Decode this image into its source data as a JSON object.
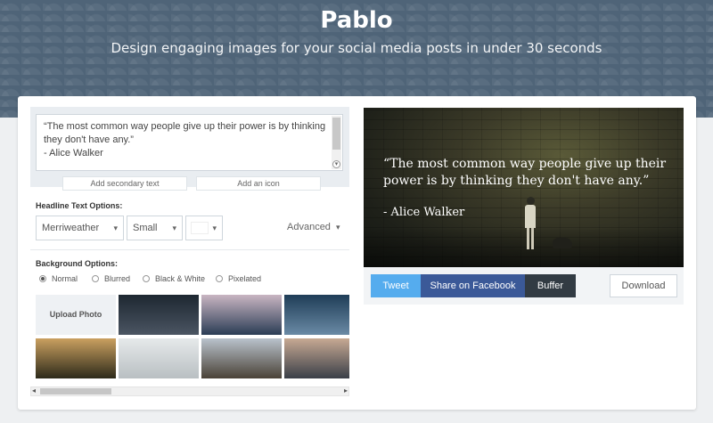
{
  "header": {
    "title": "Pablo",
    "subtitle": "Design engaging images for your social media posts in under 30 seconds"
  },
  "editor": {
    "text_lines": [
      "“The most common way people give up their power is by thinking",
      "they don't have any.”",
      "",
      "- Alice Walker"
    ],
    "add_secondary_text": "Add secondary text",
    "add_icon": "Add an icon"
  },
  "headline_options": {
    "label": "Headline Text Options:",
    "font": "Merriweather",
    "size": "Small",
    "color": "#ffffff",
    "advanced": "Advanced"
  },
  "background_options": {
    "label": "Background Options:",
    "filters": [
      "Normal",
      "Blurred",
      "Black & White",
      "Pixelated"
    ],
    "selected_filter": "Normal",
    "upload_label": "Upload Photo",
    "thumbnails": [
      {
        "name": "thumb-street",
        "colors": [
          "#1d2731",
          "#4b5562"
        ]
      },
      {
        "name": "thumb-bridge",
        "colors": [
          "#c9b5c2",
          "#2b3d55"
        ]
      },
      {
        "name": "thumb-water",
        "colors": [
          "#1f3d57",
          "#6a8aa5"
        ]
      },
      {
        "name": "thumb-sunset-forest",
        "colors": [
          "#caa060",
          "#2d2a1a"
        ]
      },
      {
        "name": "thumb-fog",
        "colors": [
          "#e6e9ea",
          "#b9bfc2"
        ]
      },
      {
        "name": "thumb-hiker",
        "colors": [
          "#b9c2cc",
          "#4a4237"
        ]
      },
      {
        "name": "thumb-city",
        "colors": [
          "#c7a993",
          "#3a3f48"
        ]
      }
    ]
  },
  "preview": {
    "quote": "“The most common way people give up their power is by thinking they don't have any.”",
    "author": "- Alice Walker"
  },
  "share": {
    "tweet": "Tweet",
    "facebook": "Share on Facebook",
    "buffer": "Buffer",
    "download": "Download"
  },
  "colors": {
    "tweet": "#55acee",
    "facebook": "#3b5998",
    "buffer": "#323b43",
    "hero": "#4f6478"
  }
}
